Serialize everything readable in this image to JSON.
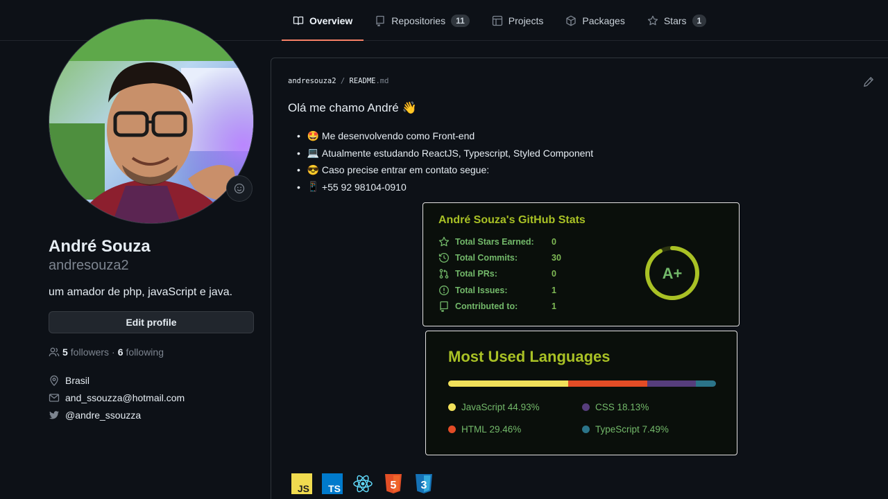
{
  "nav": {
    "tabs": [
      {
        "label": "Overview",
        "count": null
      },
      {
        "label": "Repositories",
        "count": "11"
      },
      {
        "label": "Projects",
        "count": null
      },
      {
        "label": "Packages",
        "count": null
      },
      {
        "label": "Stars",
        "count": "1"
      }
    ],
    "active_tab": "Overview"
  },
  "profile": {
    "name": "André Souza",
    "username": "andresouza2",
    "bio": "um amador de php, javaScript e java.",
    "edit_label": "Edit profile",
    "followers_count": "5",
    "followers_label": "followers",
    "separator": "·",
    "following_count": "6",
    "following_label": "following",
    "location": "Brasil",
    "email": "and_ssouzza@hotmail.com",
    "twitter": "@andre_ssouzza"
  },
  "readme": {
    "path_user": "andresouza2",
    "path_sep": "/",
    "path_file": "README",
    "path_ext": ".md",
    "heading": "Olá me chamo André",
    "heading_emoji": "👋",
    "items": [
      {
        "emoji": "🤩",
        "text": "Me desenvolvendo como Front-end"
      },
      {
        "emoji": "💻",
        "text": "Atualmente estudando ReactJS, Typescript, Styled Component"
      },
      {
        "emoji": "😎",
        "text": "Caso precise entrar em contato segue:"
      },
      {
        "emoji": "📱",
        "text": "+55 92 98104-0910"
      }
    ]
  },
  "stats_card": {
    "title": "André Souza's GitHub Stats",
    "rows": [
      {
        "label": "Total Stars Earned:",
        "value": "0",
        "icon": "star-icon"
      },
      {
        "label": "Total Commits:",
        "value": "30",
        "icon": "history-icon"
      },
      {
        "label": "Total PRs:",
        "value": "0",
        "icon": "pull-request-icon"
      },
      {
        "label": "Total Issues:",
        "value": "1",
        "icon": "issue-icon"
      },
      {
        "label": "Contributed to:",
        "value": "1",
        "icon": "repo-icon"
      }
    ],
    "grade": "A+",
    "grade_progress": 0.92,
    "colors": {
      "title": "#a9c125",
      "text": "#73b96a",
      "ring": "#a9c125",
      "bg": "#0a0f0b"
    }
  },
  "languages_card": {
    "title": "Most Used Languages",
    "languages": [
      {
        "name": "JavaScript",
        "percent": 44.93,
        "label": "44.93%",
        "color": "#f1e05a"
      },
      {
        "name": "HTML",
        "percent": 29.46,
        "label": "29.46%",
        "color": "#e34c26"
      },
      {
        "name": "CSS",
        "percent": 18.13,
        "label": "18.13%",
        "color": "#563d7c"
      },
      {
        "name": "TypeScript",
        "percent": 7.49,
        "label": "7.49%",
        "color": "#2b7489"
      }
    ]
  },
  "tech_icons": [
    {
      "name": "javascript-icon",
      "label": "JS"
    },
    {
      "name": "typescript-icon",
      "label": "TS"
    },
    {
      "name": "react-icon",
      "label": ""
    },
    {
      "name": "html5-icon",
      "label": "5"
    },
    {
      "name": "css3-icon",
      "label": "3"
    }
  ]
}
